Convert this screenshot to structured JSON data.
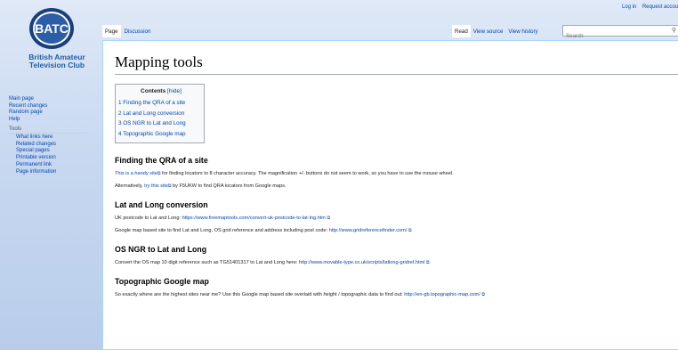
{
  "personal": {
    "login": "Log in",
    "request": "Request accou"
  },
  "logo": {
    "badge_text": "BATC",
    "line1": "British Amateur",
    "line2": "Television Club"
  },
  "sidebar": {
    "main": [
      "Main page",
      "Recent changes",
      "Random page",
      "Help"
    ],
    "tools_heading": "Tools",
    "tools": [
      "What links here",
      "Related changes",
      "Special pages",
      "Printable version",
      "Permanent link",
      "Page information"
    ]
  },
  "tabs": {
    "page": "Page",
    "discussion": "Discussion",
    "read": "Read",
    "view_source": "View source",
    "view_history": "View history"
  },
  "search": {
    "placeholder": "Search",
    "icon": "search-icon"
  },
  "content": {
    "title": "Mapping tools",
    "toc": {
      "title": "Contents",
      "hide": "[hide]",
      "items": [
        "1 Finding the QRA of a site",
        "2 Lat and Long conversion",
        "3 OS NGR to Lat and Long",
        "4 Topographic Google map"
      ]
    },
    "sections": [
      {
        "heading": "Finding the QRA of a site",
        "p1_link": "This is a handy site",
        "p1_text": " for finding locators to 8 character accuracy. The magnification +/- buttons do not seem to work, so you have to use the mouse wheel.",
        "p2_pre": "Alternatively, ",
        "p2_link": "try this site",
        "p2_post": " by F5UKW to find QRA locators from Google maps."
      },
      {
        "heading": "Lat and Long conversion",
        "p1_text": "UK postcode to Lat and Long: ",
        "p1_link": "https://www.freemaptools.com/convert-uk-postcode-to-lat-lng.htm",
        "p2_text": "Google map based site to find Lat and Long, OS grid reference and address including post code: ",
        "p2_link": "http://www.gridreferencefinder.com/"
      },
      {
        "heading": "OS NGR to Lat and Long",
        "p1_text": "Convert the OS map 10 digit reference such as TG51401317 to Lat and Long here: ",
        "p1_link": "http://www.movable-type.co.uk/scripts/latlong-gridref.html"
      },
      {
        "heading": "Topographic Google map",
        "p1_text": "So exactly where are the highest sites near me? Use this Google map based site overlaid with height / topographic data to find out: ",
        "p1_link": "http://en-gb.topographic-map.com/"
      }
    ],
    "ext_icon": "⧉"
  }
}
